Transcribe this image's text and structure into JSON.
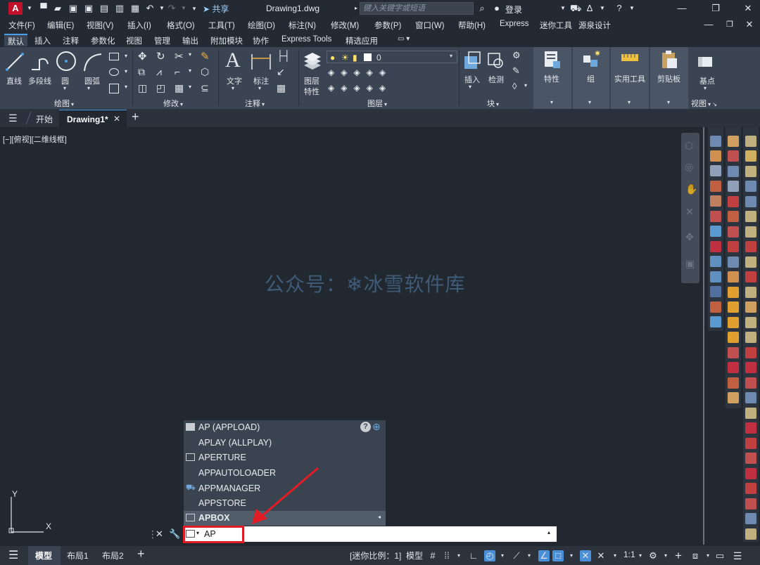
{
  "titlebar": {
    "logo": "A",
    "share": "共享",
    "title": "Drawing1.dwg",
    "search_placeholder": "键入关键字或短语",
    "login": "登录"
  },
  "menu": [
    "文件(F)",
    "编辑(E)",
    "视图(V)",
    "插入(I)",
    "格式(O)",
    "工具(T)",
    "绘图(D)",
    "标注(N)",
    "修改(M)",
    "参数(P)",
    "窗口(W)",
    "帮助(H)",
    "Express",
    "迷你工具",
    "源泉设计"
  ],
  "ribbon_tabs": [
    "默认",
    "插入",
    "注释",
    "参数化",
    "视图",
    "管理",
    "输出",
    "附加模块",
    "协作",
    "Express Tools",
    "精选应用"
  ],
  "ribbon": {
    "draw": {
      "line": "直线",
      "polyline": "多段线",
      "circle": "圆",
      "arc": "圆弧",
      "title": "绘图"
    },
    "modify": {
      "title": "修改"
    },
    "annotate": {
      "text": "文字",
      "dim": "标注",
      "title": "注释"
    },
    "layers": {
      "props_line1": "图层",
      "props_line2": "特性",
      "layer_value": "0",
      "title": "图层"
    },
    "block": {
      "insert": "插入",
      "detect": "检测",
      "title": "块"
    },
    "properties": "特性",
    "group": "组",
    "utilities": "实用工具",
    "clipboard": "剪贴板",
    "view": {
      "basepoint": "基点",
      "title": "视图"
    }
  },
  "file_tabs": {
    "start": "开始",
    "drawing": "Drawing1*"
  },
  "viewport_label": "[−][俯视][二维线框]",
  "watermark": "公众号：❄冰雪软件库",
  "ucs": {
    "y": "Y",
    "x": "X"
  },
  "autocomplete": [
    {
      "label": "AP (APPLOAD)",
      "icon": "appload-icon"
    },
    {
      "label": "APLAY (ALLPLAY)",
      "icon": ""
    },
    {
      "label": "APERTURE",
      "icon": "sysvar-icon"
    },
    {
      "label": "APPAUTOLOADER",
      "icon": ""
    },
    {
      "label": "APPMANAGER",
      "icon": "cart-icon"
    },
    {
      "label": "APPSTORE",
      "icon": ""
    },
    {
      "label": "APBOX",
      "icon": "sysvar-icon"
    }
  ],
  "command_input": "AP",
  "status": {
    "model_tab": "模型",
    "layout1": "布局1",
    "layout2": "布局2",
    "mini_scale": "[迷你比例：1]",
    "model": "模型",
    "scale": "1:1"
  },
  "colors": {
    "accent": "#4aa0e6",
    "highlight": "#e21c24",
    "logo": "#c3112b"
  }
}
